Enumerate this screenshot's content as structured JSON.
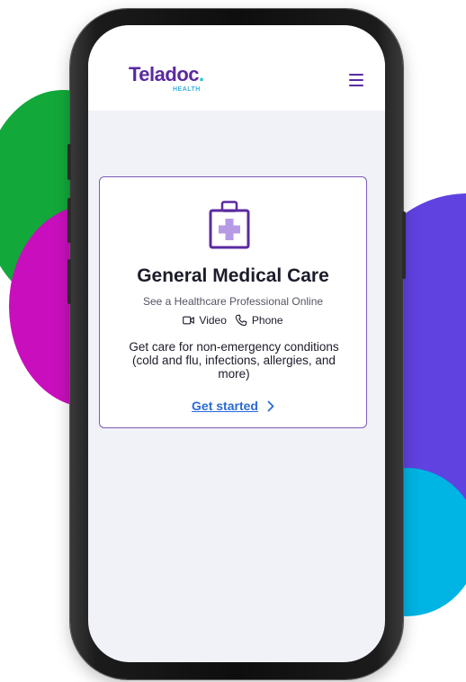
{
  "header": {
    "logo_text": "Teladoc",
    "logo_dot": ".",
    "logo_subtext": "HEALTH",
    "menu_icon": "hamburger-menu-icon"
  },
  "card": {
    "icon": "medical-kit-icon",
    "title": "General Medical Care",
    "subtitle": "See a Healthcare Professional Online",
    "modes": {
      "video_icon": "video-camera-icon",
      "video_label": "Video",
      "phone_icon": "phone-icon",
      "phone_label": "Phone"
    },
    "description": "Get care for non-emergency conditions (cold and flu, infections, allergies, and more)",
    "cta_label": "Get started",
    "cta_icon": "chevron-right-icon"
  },
  "colors": {
    "brand_purple": "#5a2aa0",
    "card_border": "#7b5bb8",
    "link_blue": "#2a6ad8",
    "screen_bg": "#f1f2f8",
    "blob_green": "#13a83a",
    "blob_magenta": "#c90fbd",
    "blob_purple": "#6042e0",
    "blob_cyan": "#00b4e3"
  }
}
